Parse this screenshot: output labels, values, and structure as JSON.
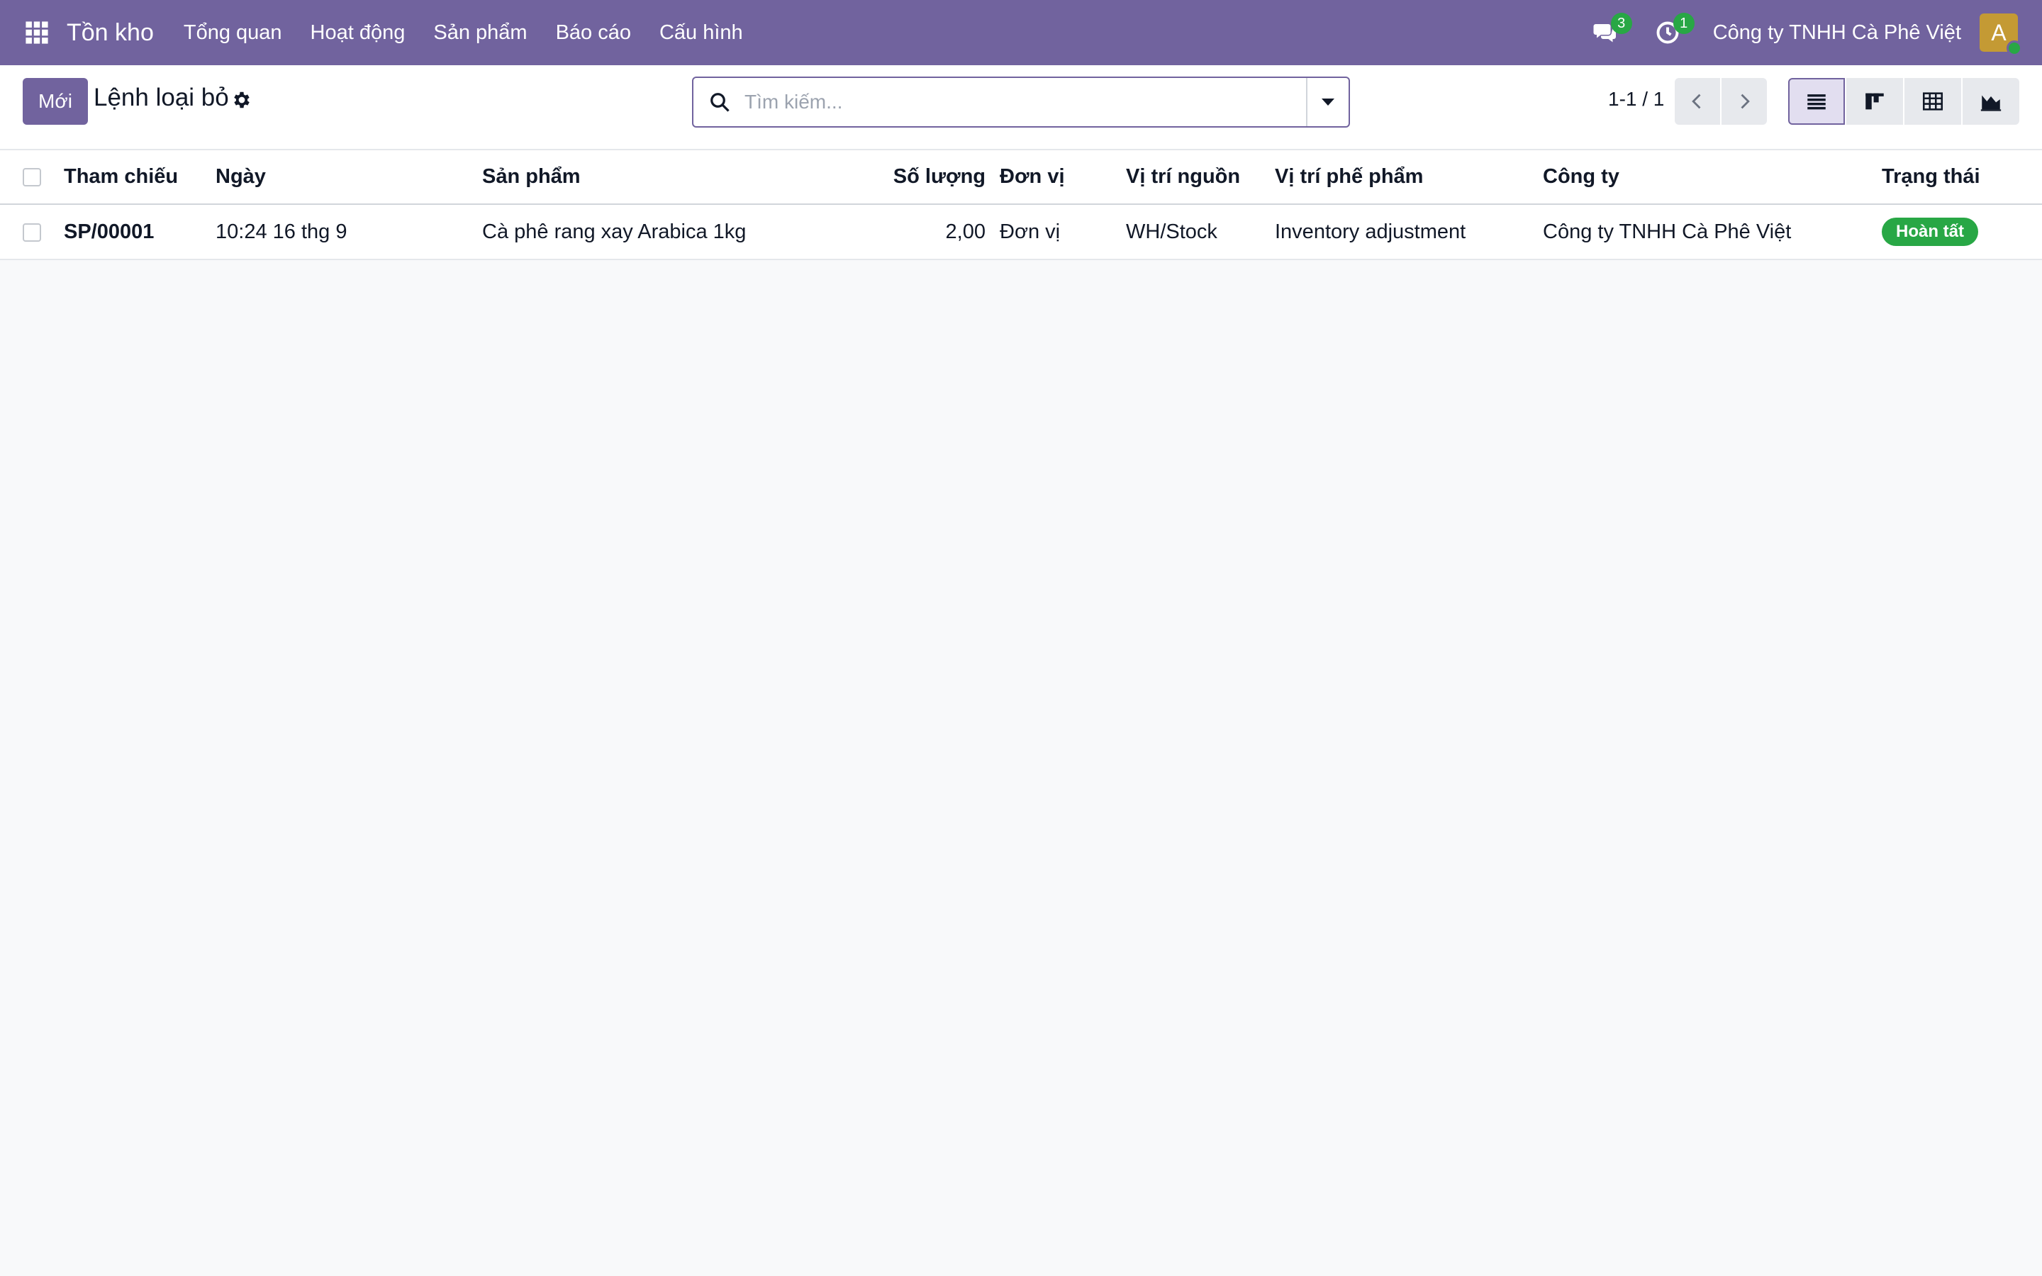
{
  "navbar": {
    "app_name": "Tồn kho",
    "menu": [
      "Tổng quan",
      "Hoạt động",
      "Sản phẩm",
      "Báo cáo",
      "Cấu hình"
    ],
    "messages_count": "3",
    "activities_count": "1",
    "company": "Công ty TNHH Cà Phê Việt",
    "avatar_letter": "A"
  },
  "control_panel": {
    "new_label": "Mới",
    "title": "Lệnh loại bỏ",
    "search_placeholder": "Tìm kiếm...",
    "pager": "1-1 / 1"
  },
  "table": {
    "headers": {
      "reference": "Tham chiếu",
      "date": "Ngày",
      "product": "Sản phẩm",
      "quantity": "Số lượng",
      "uom": "Đơn vị",
      "source_location": "Vị trí nguồn",
      "scrap_location": "Vị trí phế phẩm",
      "company": "Công ty",
      "status": "Trạng thái"
    },
    "rows": [
      {
        "reference": "SP/00001",
        "date": "10:24 16 thg 9",
        "product": "Cà phê rang xay Arabica 1kg",
        "quantity": "2,00",
        "uom": "Đơn vị",
        "source_location": "WH/Stock",
        "scrap_location": "Inventory adjustment",
        "company": "Công ty TNHH Cà Phê Việt",
        "status": "Hoàn tất"
      }
    ]
  },
  "colors": {
    "brand": "#71639e",
    "success": "#28a745"
  }
}
